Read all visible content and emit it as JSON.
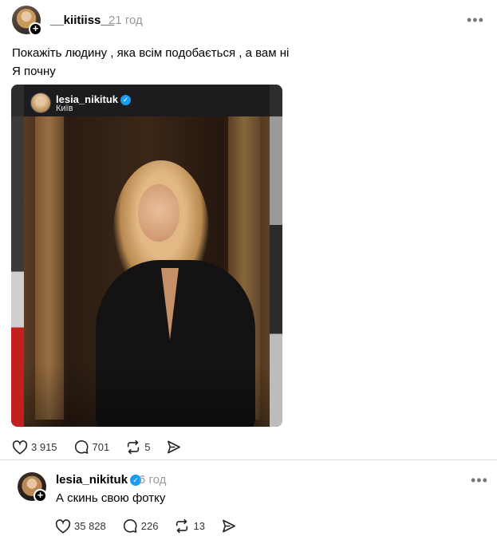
{
  "post": {
    "author": "__kiitiiss__",
    "time": "21 год",
    "text_lines": [
      "Покажіть людину , яка всім подобається , а вам ні",
      "Я почну"
    ],
    "media": {
      "username": "lesia_nikituk",
      "location": "Київ"
    },
    "stats": {
      "likes": "3 915",
      "comments": "701",
      "reposts": "5"
    }
  },
  "reply": {
    "author": "lesia_nikituk",
    "time": "6 год",
    "text": "А скинь свою фотку",
    "stats": {
      "likes": "35 828",
      "comments": "226",
      "reposts": "13"
    }
  },
  "icons": {
    "more": "more-horizontal-icon",
    "like": "heart-icon",
    "comment": "comment-icon",
    "repost": "repost-icon",
    "share": "send-icon",
    "verified": "verified-badge-icon",
    "follow": "plus-icon"
  },
  "colors": {
    "verified": "#1d9bf0",
    "muted": "#999999"
  }
}
